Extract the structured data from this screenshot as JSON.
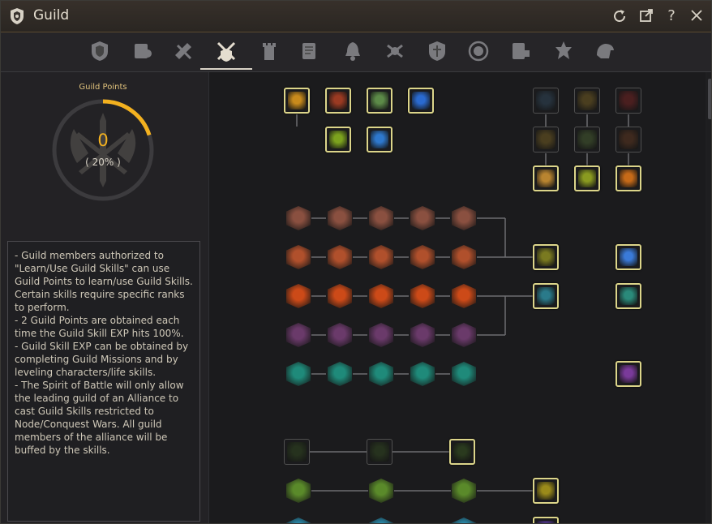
{
  "window": {
    "title": "Guild"
  },
  "titlebar_buttons": [
    {
      "name": "refresh-icon",
      "glyph": "⟳"
    },
    {
      "name": "popout-icon",
      "glyph": "⧉"
    },
    {
      "name": "help-icon",
      "glyph": "?"
    },
    {
      "name": "close-icon",
      "glyph": "✕"
    }
  ],
  "tabs": [
    {
      "name": "guild-info",
      "active": false
    },
    {
      "name": "guild-members",
      "active": false
    },
    {
      "name": "guild-quests",
      "active": false
    },
    {
      "name": "guild-skills",
      "active": true
    },
    {
      "name": "guild-castle",
      "active": false
    },
    {
      "name": "guild-warehouse",
      "active": false
    },
    {
      "name": "guild-notice",
      "active": false
    },
    {
      "name": "guild-war",
      "active": false
    },
    {
      "name": "guild-shield",
      "active": false
    },
    {
      "name": "guild-emblem",
      "active": false
    },
    {
      "name": "guild-house",
      "active": false
    },
    {
      "name": "guild-alliance",
      "active": false
    },
    {
      "name": "guild-mount",
      "active": false
    }
  ],
  "guild_points": {
    "title": "Guild Points",
    "value": "0",
    "percent_text": "( 20% )",
    "progress_fraction": 0.2,
    "accent_color": "#f3b11f"
  },
  "description": [
    "- Guild members authorized to \"Learn/Use Guild Skills\" can use Guild Points to learn/use Guild Skills. Certain skills require specific ranks to perform.",
    "- 2 Guild Points are obtained each time the Guild Skill EXP hits 100%.",
    "- Guild Skill EXP can be obtained by completing Guild Missions and by leveling characters/life skills.",
    "- The Spirit of Battle will only allow the leading guild of an Alliance to cast Guild Skills restricted to Node/Conquest Wars. All guild members of the alliance will be buffed by the skills."
  ],
  "skill_colors": {
    "gold_flame": "#c88a1c",
    "red_shield": "#9a3a22",
    "green_spirit": "#5c8a48",
    "blue_wave": "#2a6ad0",
    "lime_arrow": "#7ca21e",
    "blue_cross": "#2e78cc",
    "dark_teal": "#2a3a48",
    "dark_gold": "#5a4a20",
    "dark_red": "#5a2020",
    "dark_clover": "#3a4a2a",
    "dark_beast": "#4a2e1e",
    "gold_claw": "#b88430",
    "lime_head": "#8a9a20",
    "orange_flame": "#c66a18",
    "grey_horn": "#8a5040",
    "sword": "#b0502c",
    "fire": "#cc4a18",
    "spiral": "#6a3a6a",
    "teal_blade": "#1f8a7a",
    "olive_face": "#7a7a20",
    "blue_feather": "#3a7ad8",
    "teal_eye": "#2a7a8a",
    "teal_figure": "#2a8a7a",
    "purple_eye": "#7a3a9a",
    "dark_green": "#2a3a1e",
    "leaf": "#5a8a2a",
    "yellow_orb": "#9a8a1a",
    "cyan_orb": "#2a8aaa",
    "purple_orb": "#5a3aa0"
  }
}
